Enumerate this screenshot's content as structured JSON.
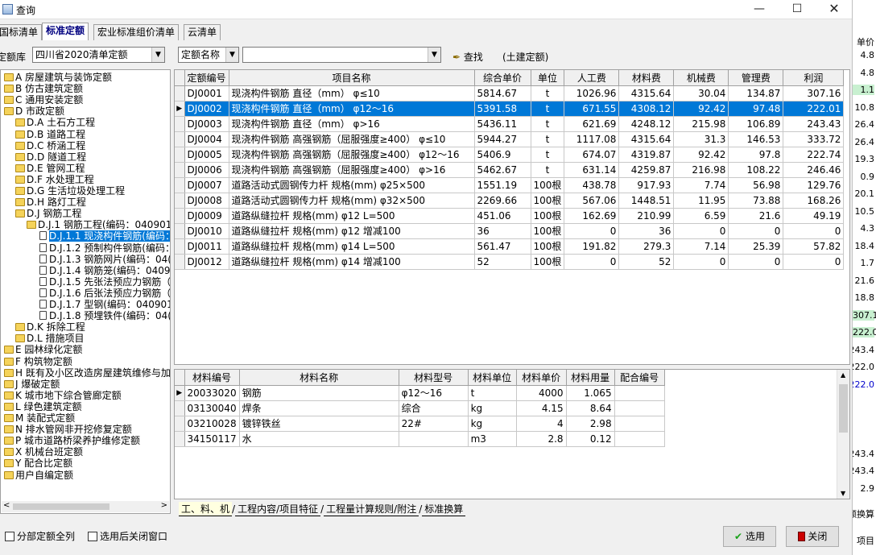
{
  "window": {
    "title": "查询"
  },
  "tabs": [
    "国标清单",
    "标准定额",
    "宏业标准组价清单",
    "云清单"
  ],
  "lib": {
    "label": "定额库",
    "value": "四川省2020清单定额"
  },
  "search": {
    "field": "定额名称",
    "value": "",
    "button": "查找",
    "scope": "(土建定额)"
  },
  "tree": [
    {
      "label": "A 房屋建筑与装饰定额",
      "level": 0,
      "kind": "folder"
    },
    {
      "label": "B 仿古建筑定额",
      "level": 0,
      "kind": "folder"
    },
    {
      "label": "C 通用安装定额",
      "level": 0,
      "kind": "folder"
    },
    {
      "label": "D 市政定额",
      "level": 0,
      "kind": "folder"
    },
    {
      "label": "D.A 土石方工程",
      "level": 1,
      "kind": "folder"
    },
    {
      "label": "D.B 道路工程",
      "level": 1,
      "kind": "folder"
    },
    {
      "label": "D.C 桥涵工程",
      "level": 1,
      "kind": "folder"
    },
    {
      "label": "D.D 隧道工程",
      "level": 1,
      "kind": "folder"
    },
    {
      "label": "D.E 管网工程",
      "level": 1,
      "kind": "folder"
    },
    {
      "label": "D.F 水处理工程",
      "level": 1,
      "kind": "folder"
    },
    {
      "label": "D.G 生活垃圾处理工程",
      "level": 1,
      "kind": "folder"
    },
    {
      "label": "D.H 路灯工程",
      "level": 1,
      "kind": "folder"
    },
    {
      "label": "D.J 钢筋工程",
      "level": 1,
      "kind": "folder"
    },
    {
      "label": "D.J.1 钢筋工程(编码：040901",
      "level": 2,
      "kind": "folder"
    },
    {
      "label": "D.J.1.1 现浇构件钢筋(编码：",
      "level": 3,
      "kind": "doc",
      "selected": true
    },
    {
      "label": "D.J.1.2 预制构件钢筋(编码：04(",
      "level": 3,
      "kind": "doc"
    },
    {
      "label": "D.J.1.3 钢筋网片(编码：04(",
      "level": 3,
      "kind": "doc"
    },
    {
      "label": "D.J.1.4 钢筋笼(编码：0409",
      "level": 3,
      "kind": "doc"
    },
    {
      "label": "D.J.1.5 先张法预应力钢筋（",
      "level": 3,
      "kind": "doc"
    },
    {
      "label": "D.J.1.6 后张法预应力钢筋（",
      "level": 3,
      "kind": "doc"
    },
    {
      "label": "D.J.1.7 型钢(编码：040901",
      "level": 3,
      "kind": "doc"
    },
    {
      "label": "D.J.1.8 预埋铁件(编码：04(",
      "level": 3,
      "kind": "doc"
    },
    {
      "label": "D.K 拆除工程",
      "level": 1,
      "kind": "folder"
    },
    {
      "label": "D.L 措施项目",
      "level": 1,
      "kind": "folder"
    },
    {
      "label": "E 园林绿化定额",
      "level": 0,
      "kind": "folder"
    },
    {
      "label": "F 构筑物定额",
      "level": 0,
      "kind": "folder"
    },
    {
      "label": "H 既有及小区改造房屋建筑维修与加",
      "level": 0,
      "kind": "folder"
    },
    {
      "label": "J 爆破定额",
      "level": 0,
      "kind": "folder"
    },
    {
      "label": "K 城市地下综合管廊定额",
      "level": 0,
      "kind": "folder"
    },
    {
      "label": "L 绿色建筑定额",
      "level": 0,
      "kind": "folder"
    },
    {
      "label": "M 装配式定额",
      "level": 0,
      "kind": "folder"
    },
    {
      "label": "N 排水管网非开挖修复定额",
      "level": 0,
      "kind": "folder"
    },
    {
      "label": "P 城市道路桥梁养护维修定额",
      "level": 0,
      "kind": "folder"
    },
    {
      "label": "X 机械台班定额",
      "level": 0,
      "kind": "folder"
    },
    {
      "label": "Y 配合比定额",
      "level": 0,
      "kind": "folder"
    },
    {
      "label": "用户自编定额",
      "level": 0,
      "kind": "folder"
    }
  ],
  "quota_table": {
    "columns": [
      "定额编号",
      "项目名称",
      "综合单价",
      "单位",
      "人工费",
      "材料费",
      "机械费",
      "管理费",
      "利润"
    ],
    "rows": [
      [
        "DJ0001",
        "现浇构件钢筋 直径（mm） φ≤10",
        "5814.67",
        "t",
        "1026.96",
        "4315.64",
        "30.04",
        "134.87",
        "307.16"
      ],
      [
        "DJ0002",
        "现浇构件钢筋 直径（mm） φ12～16",
        "5391.58",
        "t",
        "671.55",
        "4308.12",
        "92.42",
        "97.48",
        "222.01"
      ],
      [
        "DJ0003",
        "现浇构件钢筋 直径（mm） φ>16",
        "5436.11",
        "t",
        "621.69",
        "4248.12",
        "215.98",
        "106.89",
        "243.43"
      ],
      [
        "DJ0004",
        "现浇构件钢筋 高强钢筋（屈服强度≥400） φ≤10",
        "5944.27",
        "t",
        "1117.08",
        "4315.64",
        "31.3",
        "146.53",
        "333.72"
      ],
      [
        "DJ0005",
        "现浇构件钢筋 高强钢筋（屈服强度≥400） φ12～16",
        "5406.9",
        "t",
        "674.07",
        "4319.87",
        "92.42",
        "97.8",
        "222.74"
      ],
      [
        "DJ0006",
        "现浇构件钢筋 高强钢筋（屈服强度≥400） φ>16",
        "5462.67",
        "t",
        "631.14",
        "4259.87",
        "216.98",
        "108.22",
        "246.46"
      ],
      [
        "DJ0007",
        "道路活动式圆钢传力杆 规格(mm) φ25×500",
        "1551.19",
        "100根",
        "438.78",
        "917.93",
        "7.74",
        "56.98",
        "129.76"
      ],
      [
        "DJ0008",
        "道路活动式圆钢传力杆 规格(mm) φ32×500",
        "2269.66",
        "100根",
        "567.06",
        "1448.51",
        "11.95",
        "73.88",
        "168.26"
      ],
      [
        "DJ0009",
        "道路纵缝拉杆 规格(mm) φ12 L=500",
        "451.06",
        "100根",
        "162.69",
        "210.99",
        "6.59",
        "21.6",
        "49.19"
      ],
      [
        "DJ0010",
        "道路纵缝拉杆 规格(mm) φ12 增减100",
        "36",
        "100根",
        "0",
        "36",
        "0",
        "0",
        "0"
      ],
      [
        "DJ0011",
        "道路纵缝拉杆 规格(mm) φ14 L=500",
        "561.47",
        "100根",
        "191.82",
        "279.3",
        "7.14",
        "25.39",
        "57.82"
      ],
      [
        "DJ0012",
        "道路纵缝拉杆 规格(mm) φ14 增减100",
        "52",
        "100根",
        "0",
        "52",
        "0",
        "0",
        "0"
      ]
    ],
    "selected_row": 1
  },
  "material_table": {
    "columns": [
      "材料编号",
      "材料名称",
      "材料型号",
      "材料单位",
      "材料单价",
      "材料用量",
      "配合编号"
    ],
    "rows": [
      [
        "20033020",
        "钢筋",
        "φ12～16",
        "t",
        "4000",
        "1.065",
        ""
      ],
      [
        "03130040",
        "焊条",
        "综合",
        "kg",
        "4.15",
        "8.64",
        ""
      ],
      [
        "03210028",
        "镀锌铁丝",
        "22#",
        "kg",
        "4",
        "2.98",
        ""
      ],
      [
        "34150117",
        "水",
        "",
        "m3",
        "2.8",
        "0.12",
        ""
      ]
    ]
  },
  "bottom_tabs": [
    "工、料、机",
    "工程内容/项目特征",
    "工程量计算规则/附注",
    "标准换算"
  ],
  "footer": {
    "check1": "分部定额全列",
    "check2": "选用后关闭窗口",
    "select_btn": "选用",
    "close_btn": "关闭"
  },
  "right_strip": {
    "header": "单价",
    "values": [
      "4.8",
      "4.8",
      "1.1",
      "10.8",
      "26.4",
      "26.4",
      "19.3",
      "0.9",
      "20.1",
      "10.5",
      "4.3",
      "18.4",
      "1.7",
      "21.6",
      "18.8",
      "307.1",
      "222.0",
      "243.4",
      "222.0",
      "222.0",
      "",
      "",
      "",
      "243.4",
      "243.4",
      "2.9"
    ],
    "foot1": "额换算",
    "foot2": "项目"
  },
  "colors": {
    "selection": "#0078d7",
    "accent_green": "#c8f0d0"
  }
}
